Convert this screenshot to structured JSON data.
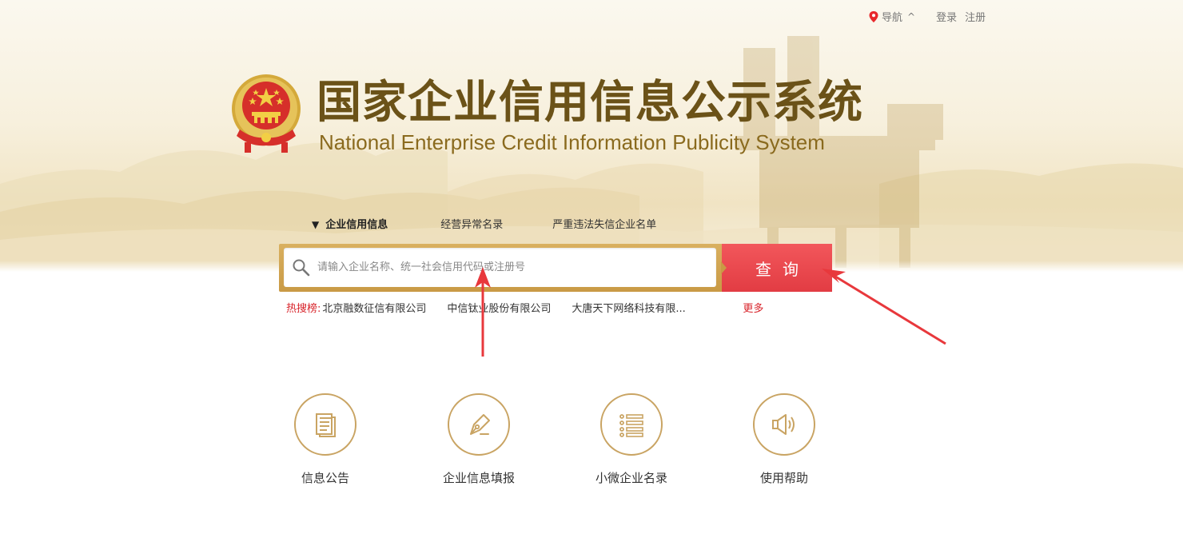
{
  "topbar": {
    "nav_label": "导航",
    "login_label": "登录",
    "register_label": "注册"
  },
  "header": {
    "title_cn": "国家企业信用信息公示系统",
    "title_en": "National Enterprise Credit Information Publicity System"
  },
  "tabs": [
    {
      "label": "企业信用信息",
      "active": true
    },
    {
      "label": "经营异常名录",
      "active": false
    },
    {
      "label": "严重违法失信企业名单",
      "active": false
    }
  ],
  "search": {
    "placeholder": "请输入企业名称、统一社会信用代码或注册号",
    "value": "",
    "button_label": "查询"
  },
  "hot_search": {
    "label": "热搜榜:",
    "items": [
      "北京融数征信有限公司",
      "中信钛业股份有限公司",
      "大唐天下网络科技有限..."
    ],
    "more_label": "更多"
  },
  "features": [
    {
      "label": "信息公告",
      "icon": "document-icon"
    },
    {
      "label": "企业信息填报",
      "icon": "pen-icon"
    },
    {
      "label": "小微企业名录",
      "icon": "list-icon"
    },
    {
      "label": "使用帮助",
      "icon": "speaker-icon"
    }
  ],
  "colors": {
    "brand_gold": "#c9a463",
    "title_brown": "#6b5218",
    "accent_red": "#e23c43",
    "hot_red": "#d8232a"
  }
}
